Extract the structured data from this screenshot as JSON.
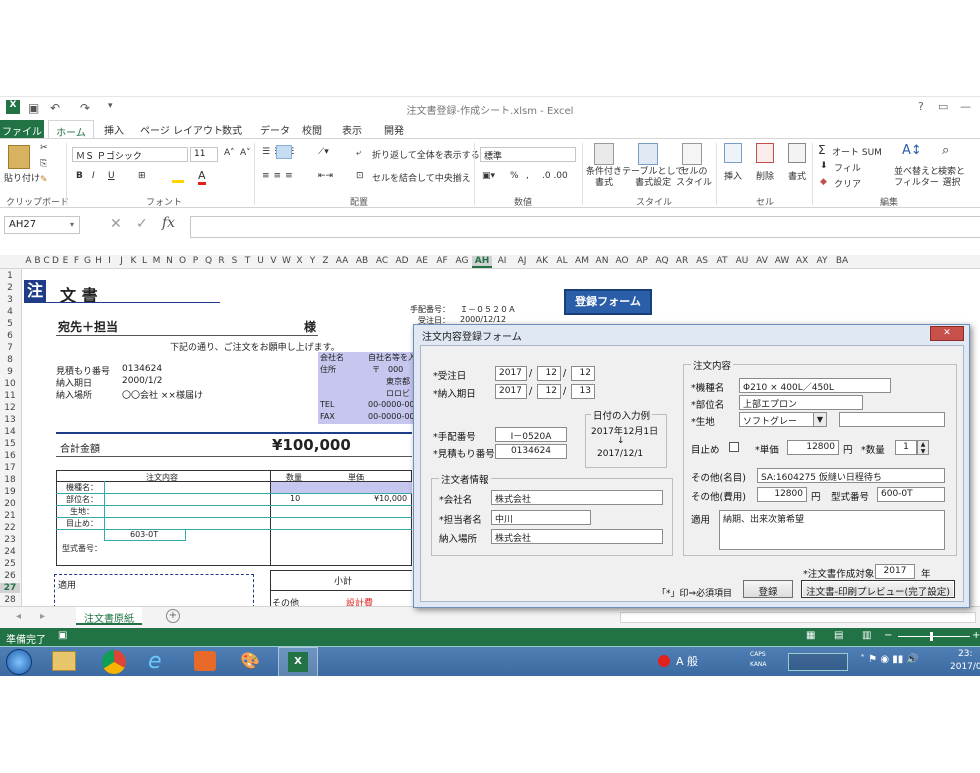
{
  "window": {
    "title": "注文書登録-作成シート.xlsm - Excel",
    "help": "?",
    "min": "—",
    "close": "✕"
  },
  "ribbon": {
    "tabs": [
      "ファイル",
      "ホーム",
      "挿入",
      "ページ レイアウト",
      "数式",
      "データ",
      "校閲",
      "表示",
      "開発"
    ],
    "clipboard": {
      "paste": "貼り付け",
      "label": "クリップボード"
    },
    "font": {
      "name": "ＭＳ Ｐゴシック",
      "size": "11",
      "label": "フォント",
      "bold": "B",
      "italic": "I",
      "underline": "U"
    },
    "alignment": {
      "wrap": "折り返して全体を表示する",
      "merge": "セルを結合して中央揃え",
      "label": "配置"
    },
    "number": {
      "format": "標準",
      "percent": "%",
      "comma": ",",
      "label": "数値"
    },
    "styles": {
      "cond": "条件付き\n書式",
      "table": "テーブルとして\n書式設定",
      "cellstyle": "セルの\nスタイル",
      "label": "スタイル"
    },
    "cells": {
      "insert": "挿入",
      "delete": "削除",
      "format": "書式",
      "label": "セル"
    },
    "editing": {
      "autosum": "オート SUM",
      "fill": "フィル",
      "clear": "クリア",
      "sort": "並べ替えと\nフィルター",
      "find": "検索と\n選択",
      "label": "編集"
    }
  },
  "formula_bar": {
    "name_box": "AH27",
    "fx": "fx",
    "cancel": "✕",
    "enter": "✓"
  },
  "columns": [
    "A",
    "B",
    "C",
    "D",
    "E",
    "F",
    "G",
    "H",
    "I",
    "J",
    "K",
    "L",
    "M",
    "N",
    "O",
    "P",
    "Q",
    "R",
    "S",
    "T",
    "U",
    "V",
    "W",
    "X",
    "Y",
    "Z",
    "AA",
    "AB",
    "AC",
    "AD",
    "AE",
    "AF",
    "AG",
    "AH",
    "AI",
    "AJ",
    "AK",
    "AL",
    "AM",
    "AN",
    "AO",
    "AP",
    "AQ",
    "AR",
    "AS",
    "AT",
    "AU",
    "AV",
    "AW",
    "AX",
    "AY",
    "BA"
  ],
  "rows": [
    "1",
    "2",
    "3",
    "4",
    "5",
    "6",
    "7",
    "8",
    "9",
    "10",
    "11",
    "12",
    "13",
    "14",
    "15",
    "16",
    "17",
    "18",
    "19",
    "20",
    "21",
    "22",
    "23",
    "24",
    "25",
    "26",
    "27",
    "28"
  ],
  "sheet": {
    "title_a": "注",
    "title_b": "文 書",
    "recipient": "宛先＋担当",
    "sama": "様",
    "intro": "下記の通り、ご注文をお願申し上げます。",
    "est_label": "見積もり番号",
    "est_value": "0134624",
    "deliv_label": "納入期日",
    "deliv_value": "2000/1/2",
    "place_label": "納入場所",
    "place_value": "〇〇会社 ××様届け",
    "co_label": "会社名",
    "co_value": "自社名等を入",
    "addr_label": "住所",
    "addr_1": "〒　000",
    "addr_2": "東京都",
    "addr_3": "ロロビ",
    "tel_label": "TEL",
    "tel_value": "00-0000-00",
    "fax_label": "FAX",
    "fax_value": "00-0000-00",
    "order_no_label": "手配番号：",
    "order_no_value": "Ｉ－０５２０Ａ",
    "recv_label": "受注日：",
    "recv_value": "2000/12/12",
    "total_label": "合計金額",
    "total_value": "¥100,000",
    "th_content": "注文内容",
    "th_qty": "数量",
    "th_price": "単価",
    "r_kishu": "機種名：",
    "r_busin": "部位名：",
    "r_kiji": "生地：",
    "r_meyame": "目止め：",
    "r_kata": "型式番号：",
    "qty": "10",
    "price": "¥10,000",
    "kata_code": "603-0T",
    "tekiyo": "適用",
    "subtotal": "小計",
    "sonota": "その他",
    "sekkei": "設計費",
    "register_btn": "登録フォーム",
    "tab_name": "注文書原紙",
    "add_tab": "+"
  },
  "status": {
    "ready": "準備完了"
  },
  "dialog": {
    "title": "注文内容登録フォーム",
    "close": "✕",
    "juchu_label": "*受注日",
    "juchu_y": "2017",
    "juchu_m": "12",
    "juchu_d": "12",
    "nyuki_label": "*納入期日",
    "nyuki_y": "2017",
    "nyuki_m": "12",
    "nyuki_d": "13",
    "slash": "/",
    "tehai_label": "*手配番号",
    "tehai_value": "I－0520A",
    "mitsu_label": "*見積もり番号",
    "mitsu_value": "0134624",
    "date_ex_title": "日付の入力例",
    "date_ex_1": "2017年12月1日",
    "date_ex_arrow": "↓",
    "date_ex_2": "2017/12/1",
    "orderer_group": "注文者情報",
    "company_label": "*会社名",
    "company_value": "株式会社",
    "person_label": "*担当者名",
    "person_value": "中川",
    "place_label": "納入場所",
    "place_value": "株式会社",
    "content_group": "注文内容",
    "kishu_label": "*機種名",
    "kishu_value": "Φ210 × 400L／450L",
    "buhin_label": "*部位名",
    "buhin_value": "上部エプロン",
    "kiji_label": "*生地",
    "kiji_value": "ソフトグレー",
    "meyame_label": "目止め",
    "tanka_label": "*単価",
    "tanka_value": "12800",
    "yen": "円",
    "suryo_label": "*数量",
    "suryo_value": "1",
    "sonota_name_label": "その他(名目)",
    "sonota_name_value": "SA:1604275 仮縫い日程待ち",
    "sonota_cost_label": "その他(費用)",
    "sonota_cost_value": "12800",
    "kata_label": "型式番号",
    "kata_value": "600-0T",
    "tekiyo_label": "適用",
    "tekiyo_value": "納期、出来次第希望",
    "target_label": "*注文書作成対象",
    "target_value": "2017",
    "nen": "年",
    "required_note": "「*」印⇒必須項目",
    "register": "登録",
    "preview": "注文書-印刷プレビュー(完了設定)"
  },
  "taskbar": {
    "ime": "A 般",
    "caps": "CAPS",
    "kana": "KANA",
    "time": "23:",
    "date": "2017/0"
  },
  "colors": {
    "excel_green": "#217346",
    "dialog_frame": "#6d8fb8",
    "button_blue": "#2a5ea8"
  }
}
